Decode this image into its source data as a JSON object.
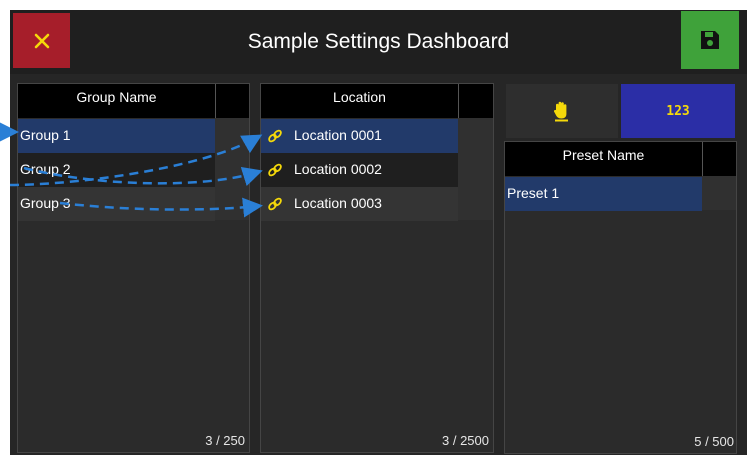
{
  "header": {
    "title": "Sample Settings Dashboard",
    "close_icon": "close-icon",
    "save_icon": "save-icon"
  },
  "groups": {
    "column_header": "Group Name",
    "items": [
      "Group 1",
      "Group 2",
      "Group 3"
    ],
    "count": "3 / 250"
  },
  "locations": {
    "column_header": "Location",
    "items": [
      "Location 0001",
      "Location 0002",
      "Location 0003"
    ],
    "count": "3 / 2500"
  },
  "presets": {
    "manual_icon": "hand-icon",
    "numeric_label": "123",
    "column_header": "Preset Name",
    "items": [
      "Preset 1"
    ],
    "count": "5 / 500"
  },
  "colors": {
    "accent_yellow": "#f5d90a",
    "close_red": "#a61e2a",
    "save_green": "#3fa23a",
    "selection_blue": "#223a6a",
    "numeric_button_blue": "#2b2ea6",
    "arrow_blue": "#2a7fd6"
  }
}
